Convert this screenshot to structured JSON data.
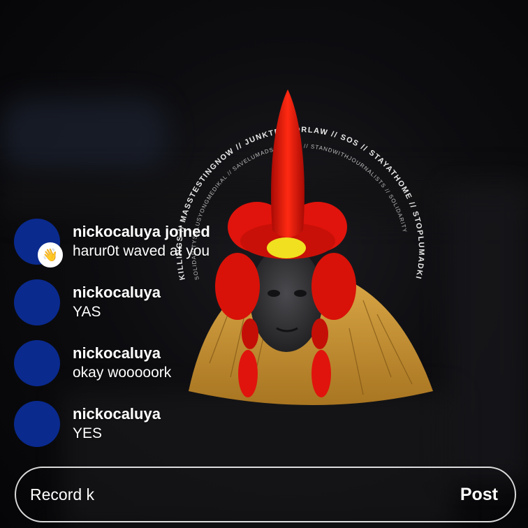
{
  "live": {
    "comments": [
      {
        "user": "nickocaluya joined",
        "message": "harur0t waved at you",
        "badge_icon": "waving-hand-icon"
      },
      {
        "user": "nickocaluya",
        "message": "YAS"
      },
      {
        "user": "nickocaluya",
        "message": "okay wooooork"
      },
      {
        "user": "nickocaluya",
        "message": "YES"
      }
    ],
    "input": {
      "value": "Record k",
      "post_label": "Post"
    },
    "halo_text": "KILLINGS // MASSTESTINGNOW // JUNKTERRORLAW // SOS // STAYATHOME // STOPLUMADKILLINGS",
    "colors": {
      "avatar": "#0a2a8e",
      "crest": "#e0140c",
      "hair": "#d9a33a",
      "gem": "#f0e020"
    }
  }
}
